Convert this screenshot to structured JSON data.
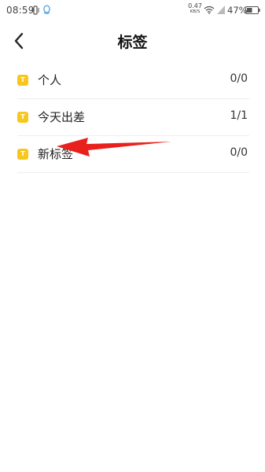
{
  "status_bar": {
    "time": "08:59",
    "net_speed_value": "0.47",
    "net_speed_unit": "KB/S",
    "battery": "47%",
    "icons": [
      "vibrate-icon",
      "qq-notification-icon",
      "wifi-icon",
      "signal-icon",
      "battery-icon"
    ]
  },
  "header": {
    "title": "标签",
    "back_icon": "chevron-left-icon"
  },
  "tags": [
    {
      "badge": "T",
      "name": "个人",
      "count": "0/0"
    },
    {
      "badge": "T",
      "name": "今天出差",
      "count": "1/1"
    },
    {
      "badge": "T",
      "name": "新标签",
      "count": "0/0"
    }
  ],
  "colors": {
    "badge": "#f7c71c",
    "annotation_arrow": "#e8211d",
    "divider": "#eeeeee"
  }
}
